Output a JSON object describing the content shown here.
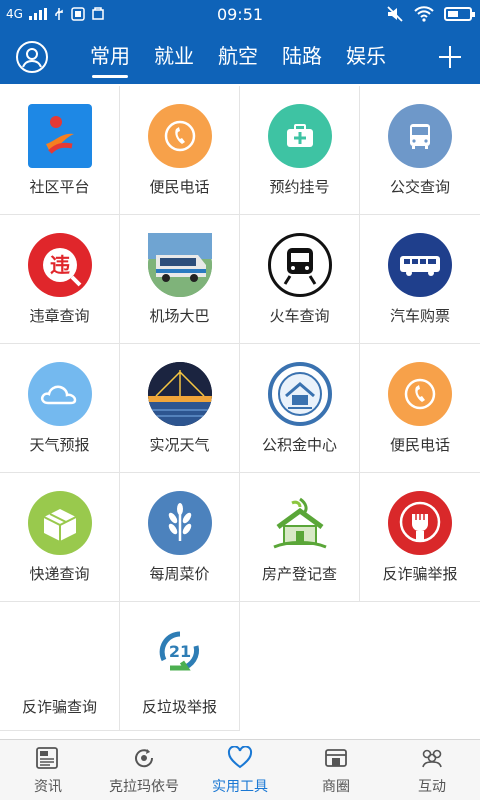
{
  "status_bar": {
    "network": "4G",
    "time": "09:51"
  },
  "nav": {
    "tabs": [
      "常用",
      "就业",
      "航空",
      "陆路",
      "娱乐"
    ],
    "active_tab": "常用"
  },
  "grid": [
    {
      "label": "社区平台",
      "icon": "community-logo",
      "color": "#1e88e5"
    },
    {
      "label": "便民电话",
      "icon": "phone-icon",
      "color": "#f7a14a"
    },
    {
      "label": "预约挂号",
      "icon": "medkit-icon",
      "color": "#3ec3a3"
    },
    {
      "label": "公交查询",
      "icon": "bus-icon",
      "color": "#6e98c9"
    },
    {
      "label": "违章查询",
      "icon": "violation-icon",
      "color": "#e0262b"
    },
    {
      "label": "机场大巴",
      "icon": "airport-bus-photo",
      "color": "#6aa86c"
    },
    {
      "label": "火车查询",
      "icon": "train-icon",
      "color": "#111111"
    },
    {
      "label": "汽车购票",
      "icon": "coach-icon",
      "color": "#1f3f8c"
    },
    {
      "label": "天气预报",
      "icon": "cloud-icon",
      "color": "#74b9ef"
    },
    {
      "label": "实况天气",
      "icon": "night-bridge-photo",
      "color": "#1b2440"
    },
    {
      "label": "公积金中心",
      "icon": "housing-fund-logo",
      "color": "#3a72b0"
    },
    {
      "label": "便民电话",
      "icon": "phone-icon",
      "color": "#f7a14a"
    },
    {
      "label": "快递查询",
      "icon": "package-icon",
      "color": "#99c94d"
    },
    {
      "label": "每周菜价",
      "icon": "wheat-icon",
      "color": "#4c82bd"
    },
    {
      "label": "房产登记查",
      "icon": "green-house-icon",
      "color": "#5aa638"
    },
    {
      "label": "反诈骗举报",
      "icon": "fist-icon",
      "color": "#d9282a"
    },
    {
      "label": "反诈骗查询",
      "icon": "none",
      "color": "#ffffff"
    },
    {
      "label": "反垃圾举报",
      "icon": "recycle-21-icon",
      "color": "#2e7db5"
    }
  ],
  "bottom_nav": [
    {
      "label": "资讯",
      "icon": "news-icon"
    },
    {
      "label": "克拉玛依号",
      "icon": "refresh-circle-icon"
    },
    {
      "label": "实用工具",
      "icon": "heart-icon"
    },
    {
      "label": "商圈",
      "icon": "storefront-icon"
    },
    {
      "label": "互动",
      "icon": "people-icon"
    }
  ],
  "active_bottom": "实用工具",
  "colors": {
    "primary": "#0f63b8",
    "active_bottom": "#1a78d4"
  }
}
